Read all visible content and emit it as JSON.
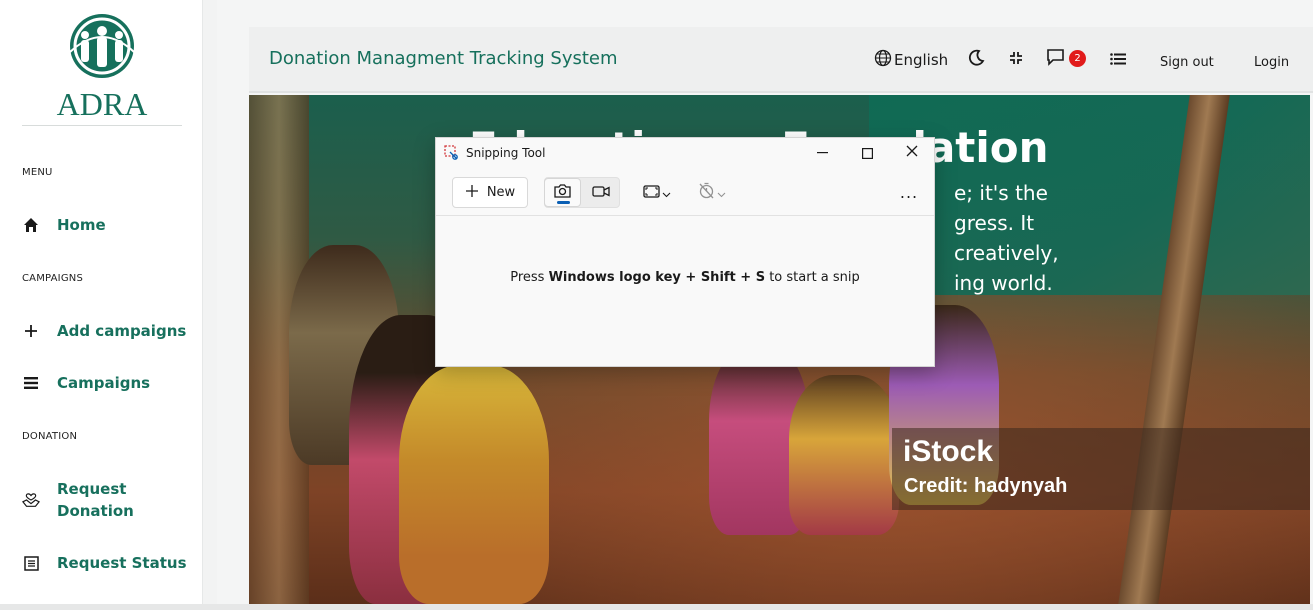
{
  "brand": {
    "logo_text": "ADRA",
    "accent": "#16705c"
  },
  "sidebar": {
    "sections": {
      "menu": "MENU",
      "campaigns": "CAMPAIGNS",
      "donation": "DONATION"
    },
    "items": [
      {
        "label": "Home",
        "icon": "home-icon"
      },
      {
        "label": "Add campaigns",
        "icon": "plus-icon"
      },
      {
        "label": "Campaigns",
        "icon": "list-icon"
      },
      {
        "label": "Request Donation",
        "icon": "hands-heart-icon"
      },
      {
        "label": "Request Status",
        "icon": "status-list-icon"
      }
    ]
  },
  "header": {
    "title": "Donation Managment Tracking System",
    "language": "English",
    "notification_count": "2",
    "sign_out": "Sign out",
    "login": "Login"
  },
  "hero": {
    "heading": "Education ... Foundation",
    "lines": [
      "e; it's the",
      "gress. It",
      "creatively,",
      "ing world."
    ],
    "stock_logo": "iStock",
    "stock_credit": "Credit: hadynyah"
  },
  "snipping_tool": {
    "title": "Snipping Tool",
    "new_label": "New",
    "hint_prefix": "Press ",
    "hint_keys": "Windows logo key + Shift + S",
    "hint_suffix": " to start a snip",
    "more": "..."
  }
}
